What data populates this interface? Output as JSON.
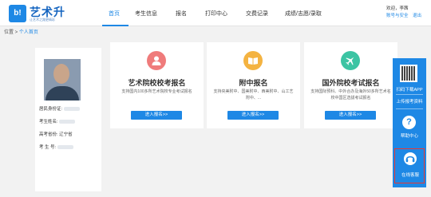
{
  "logo": {
    "mark": "b!",
    "name": "艺术升",
    "sub": "让艺术之路更精彩"
  },
  "nav": [
    {
      "label": "首页"
    },
    {
      "label": "考生信息"
    },
    {
      "label": "报名"
    },
    {
      "label": "打印中心"
    },
    {
      "label": "交费记录"
    },
    {
      "label": "成绩/志愿/录取"
    }
  ],
  "user": {
    "greeting": "欢迎，李茜",
    "account_security": "账号与安全",
    "logout": "退出"
  },
  "breadcrumb": {
    "prefix": "位置 > ",
    "home": "个人首页"
  },
  "profile": {
    "id_label": "居民身份证:",
    "name_label": "考生姓名:",
    "province_label": "高考省份:",
    "province_value": "辽宁省",
    "exam_no_label": "考 生 号:"
  },
  "cards": [
    {
      "title": "艺术院校校考报名",
      "desc": "支持国内100多所艺术院校专业考试报名",
      "button": "进入报名>>",
      "icon": "user-icon",
      "color": "#ef7b7b"
    },
    {
      "title": "附中报名",
      "desc": "支持央美附中、国美附中、西美附中、山工艺附中、...",
      "button": "进入报名>>",
      "icon": "book-icon",
      "color": "#f4b341"
    },
    {
      "title": "国外院校考试报名",
      "desc": "支持国际预科、中外合办及海外50多所艺术名校中国区选拔考试报名",
      "button": "进入报名>>",
      "icon": "plane-icon",
      "color": "#3cc4a3"
    }
  ],
  "side": {
    "download": "扫码下载APP",
    "upload": "上传报考资料",
    "help": "帮助中心",
    "service": "在线客服"
  }
}
